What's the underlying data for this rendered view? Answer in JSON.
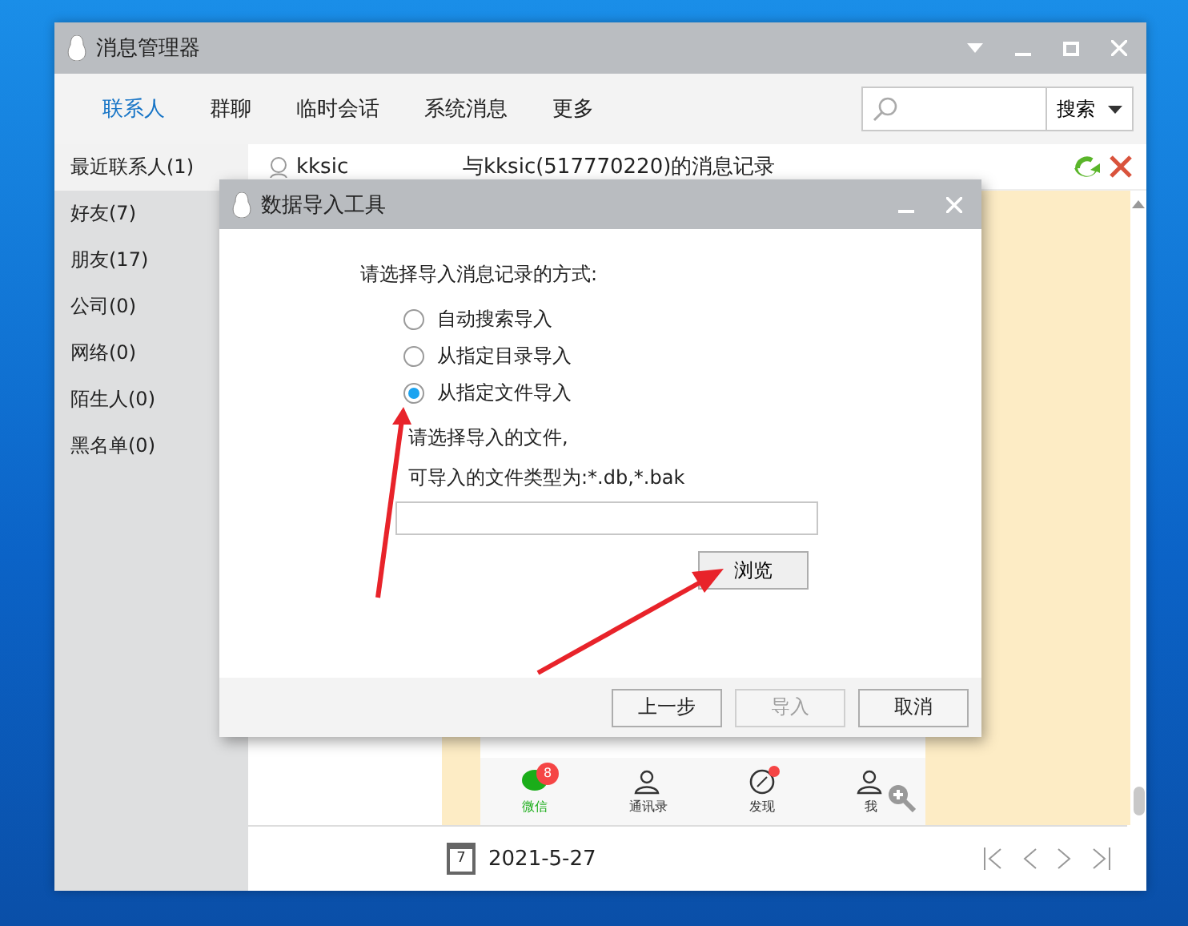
{
  "window": {
    "title": "消息管理器"
  },
  "tabs": [
    {
      "label": "联系人",
      "selected": true
    },
    {
      "label": "群聊",
      "selected": false
    },
    {
      "label": "临时会话",
      "selected": false
    },
    {
      "label": "系统消息",
      "selected": false
    },
    {
      "label": "更多",
      "selected": false
    }
  ],
  "search": {
    "button": "搜索"
  },
  "sidebar": {
    "items": [
      {
        "label": "最近联系人(1)",
        "selected": true
      },
      {
        "label": "好友(7)",
        "selected": false
      },
      {
        "label": "朋友(17)",
        "selected": false
      },
      {
        "label": "公司(0)",
        "selected": false
      },
      {
        "label": "网络(0)",
        "selected": false
      },
      {
        "label": "陌生人(0)",
        "selected": false
      },
      {
        "label": "黑名单(0)",
        "selected": false
      }
    ]
  },
  "conversation": {
    "contact": "kksic",
    "title": "与kksic(517770220)的消息记录",
    "preview_nav": [
      {
        "label": "微信",
        "badge": "8",
        "dot": false,
        "selected": true
      },
      {
        "label": "通讯录",
        "dot": false,
        "selected": false
      },
      {
        "label": "发现",
        "dot": true,
        "selected": false
      },
      {
        "label": "我",
        "dot": false,
        "selected": false
      }
    ],
    "calendar_day": "7",
    "date": "2021-5-27"
  },
  "dialog": {
    "title": "数据导入工具",
    "prompt": "请选择导入消息记录的方式:",
    "options": [
      {
        "label": "自动搜索导入",
        "selected": false
      },
      {
        "label": "从指定目录导入",
        "selected": false
      },
      {
        "label": "从指定文件导入",
        "selected": true
      }
    ],
    "file_hint": [
      "请选择导入的文件,",
      "可导入的文件类型为:*.db,*.bak"
    ],
    "browse": "浏览",
    "buttons": [
      {
        "label": "上一步",
        "disabled": false
      },
      {
        "label": "导入",
        "disabled": true
      },
      {
        "label": "取消",
        "disabled": false
      }
    ]
  }
}
